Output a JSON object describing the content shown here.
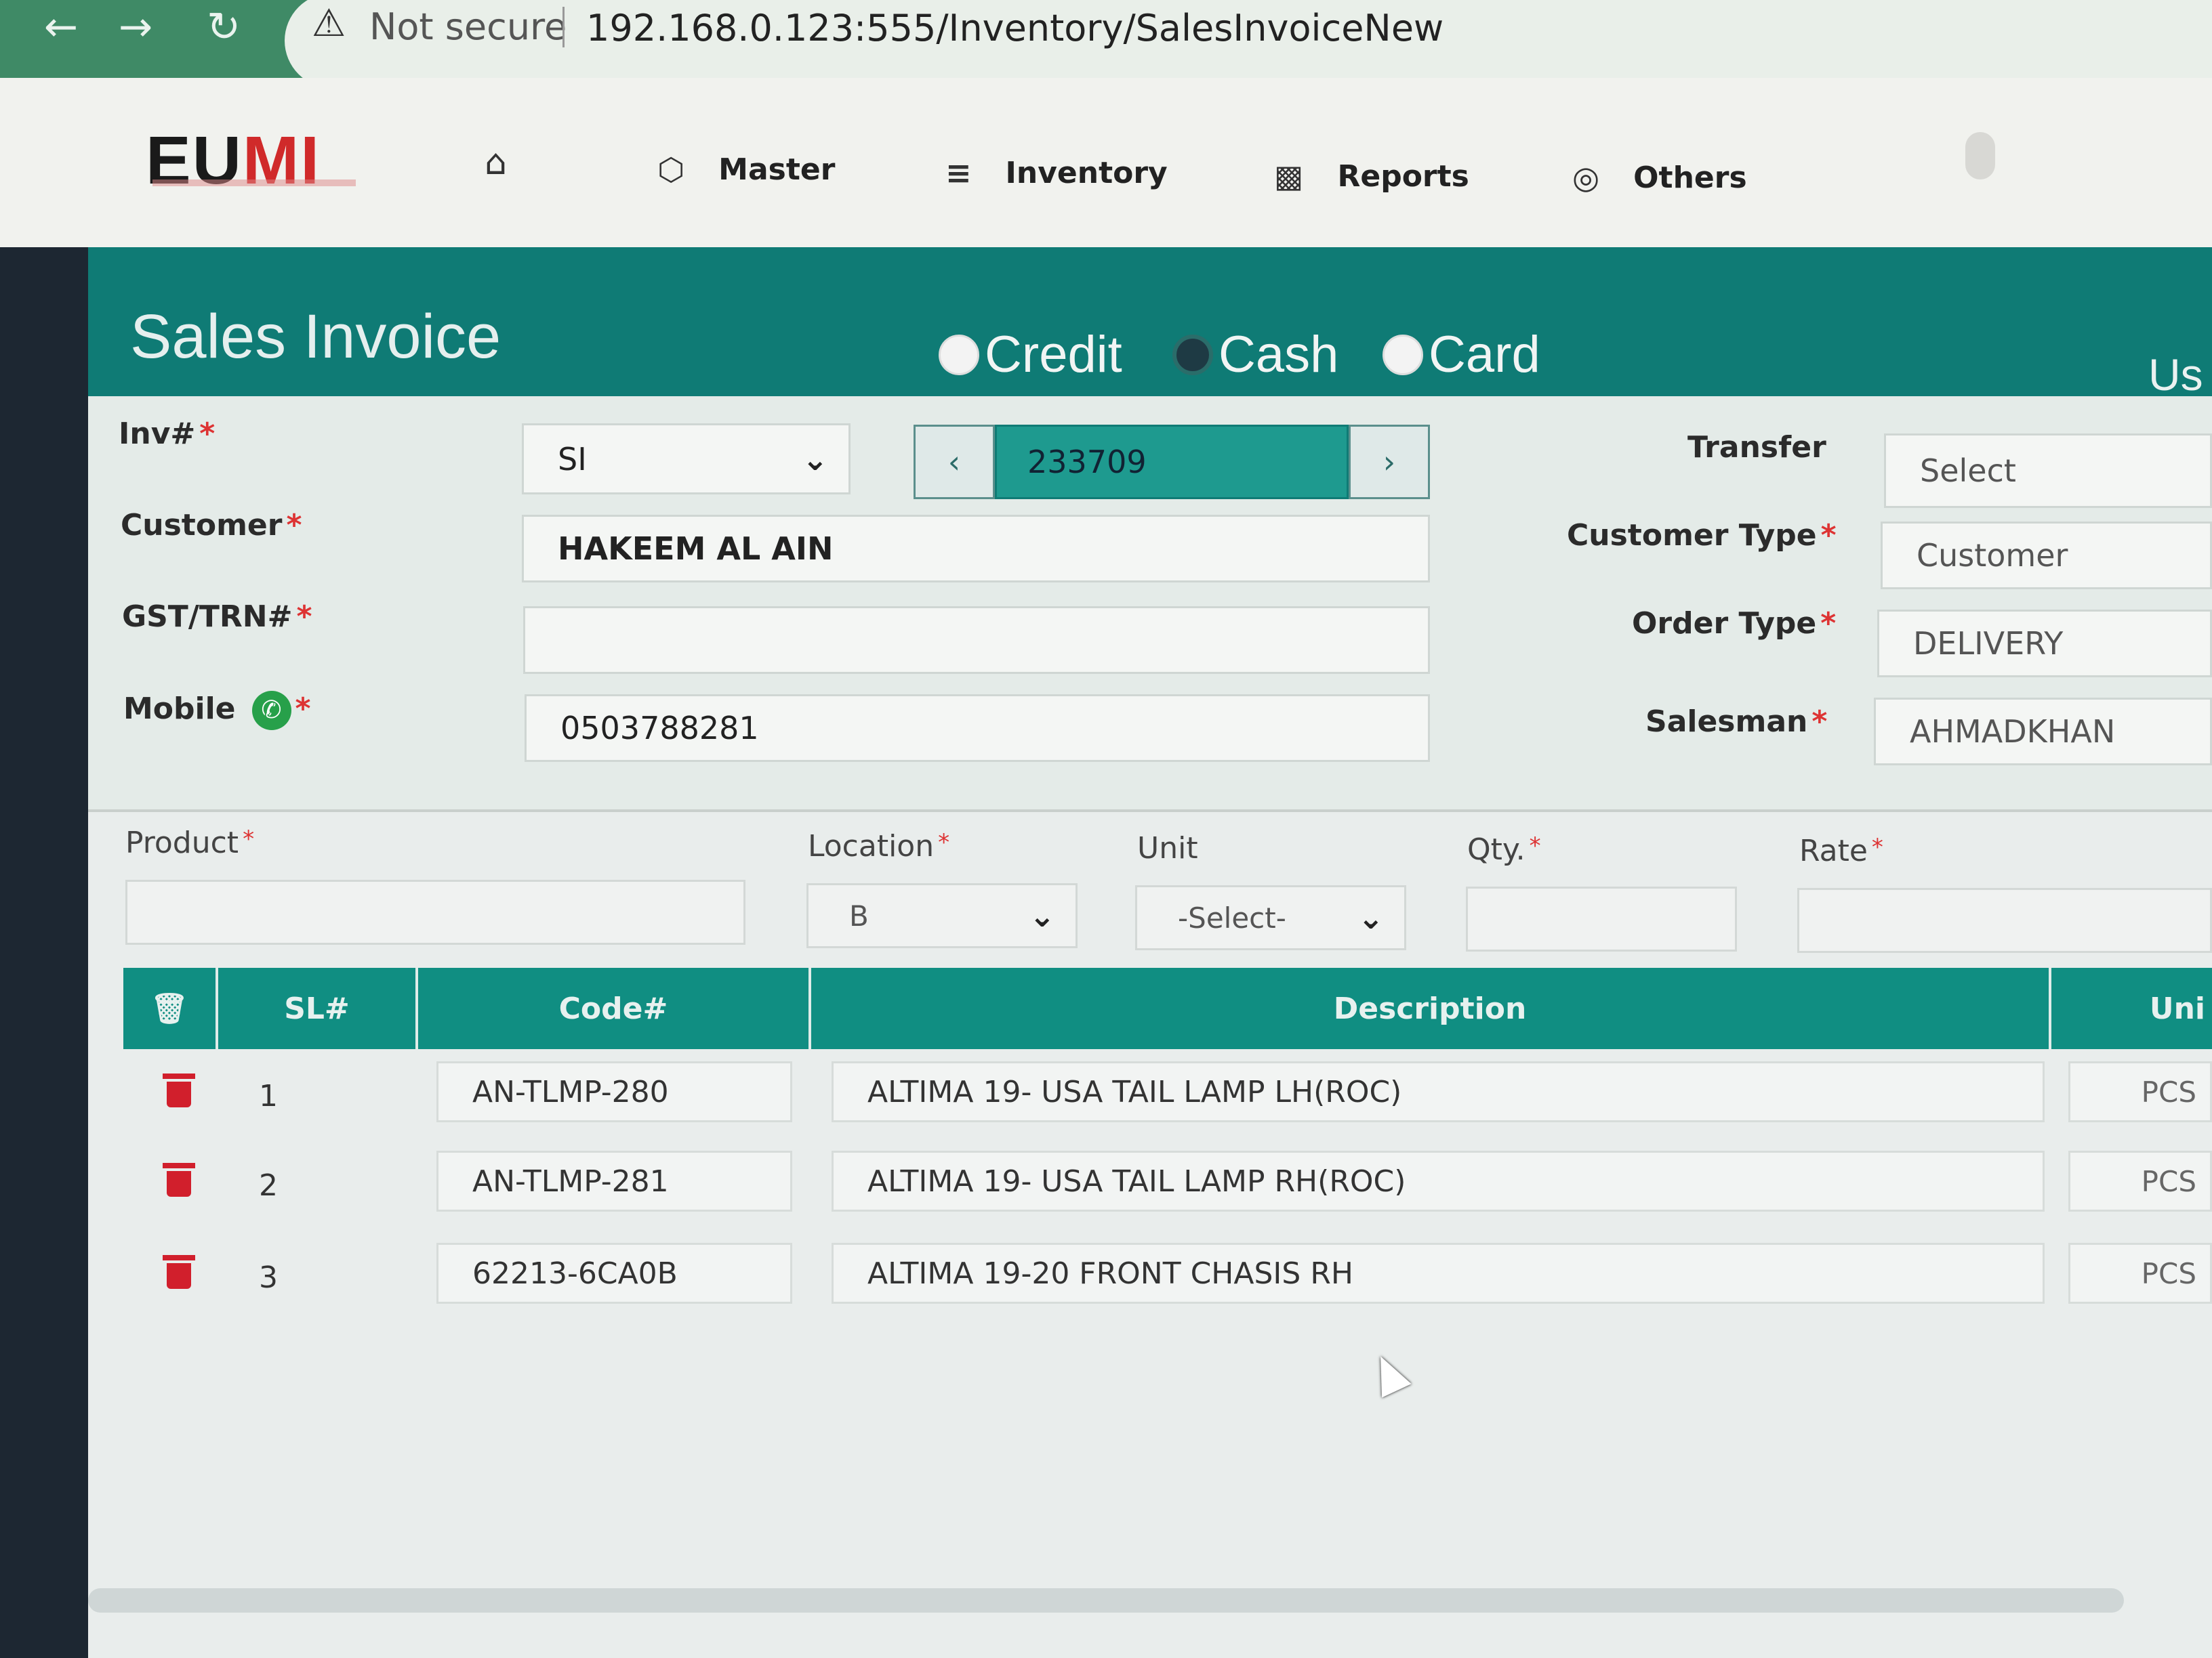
{
  "browser": {
    "security_label": "Not secure",
    "url": "192.168.0.123:555/Inventory/SalesInvoiceNew"
  },
  "app": {
    "logo_text_1": "EU",
    "logo_text_2": "MI",
    "menu": [
      {
        "label": "Master",
        "icon": "cube-icon"
      },
      {
        "label": "Inventory",
        "icon": "layers-icon"
      },
      {
        "label": "Reports",
        "icon": "bar-chart-icon"
      },
      {
        "label": "Others",
        "icon": "globe-icon"
      }
    ]
  },
  "page": {
    "title": "Sales Invoice",
    "payment_modes": [
      {
        "label": "Credit",
        "selected": false
      },
      {
        "label": "Cash",
        "selected": true
      },
      {
        "label": "Card",
        "selected": false
      }
    ],
    "right_header_text": "Us"
  },
  "form": {
    "inv_label": "Inv#",
    "inv_prefix": "SI",
    "inv_number": "233709",
    "customer_label": "Customer",
    "customer_value": "HAKEEM AL AIN",
    "gst_label": "GST/TRN#",
    "gst_value": "",
    "mobile_label": "Mobile",
    "mobile_value": "0503788281",
    "transfer_label": "Transfer",
    "transfer_value": "Select",
    "customer_type_label": "Customer Type",
    "customer_type_value": "Customer",
    "order_type_label": "Order Type",
    "order_type_value": "DELIVERY",
    "salesman_label": "Salesman",
    "salesman_value": "AHMADKHAN"
  },
  "product_entry": {
    "product_label": "Product",
    "location_label": "Location",
    "location_value": "B",
    "unit_label": "Unit",
    "unit_value": "-Select-",
    "qty_label": "Qty.",
    "rate_label": "Rate"
  },
  "table": {
    "headers": {
      "sl": "SL#",
      "code": "Code#",
      "description": "Description",
      "unit": "Uni"
    },
    "rows": [
      {
        "sl": "1",
        "code": "AN-TLMP-280",
        "description": "ALTIMA 19- USA TAIL LAMP LH(ROC)",
        "unit": "PCS"
      },
      {
        "sl": "2",
        "code": "AN-TLMP-281",
        "description": "ALTIMA 19- USA TAIL LAMP RH(ROC)",
        "unit": "PCS"
      },
      {
        "sl": "3",
        "code": "62213-6CA0B",
        "description": "ALTIMA 19-20 FRONT CHASIS RH",
        "unit": "PCS"
      }
    ]
  },
  "colors": {
    "header_teal": "#0f7b75",
    "table_head_teal": "#108e82",
    "delete_red": "#d11f2c",
    "whatsapp_green": "#27a04a"
  }
}
